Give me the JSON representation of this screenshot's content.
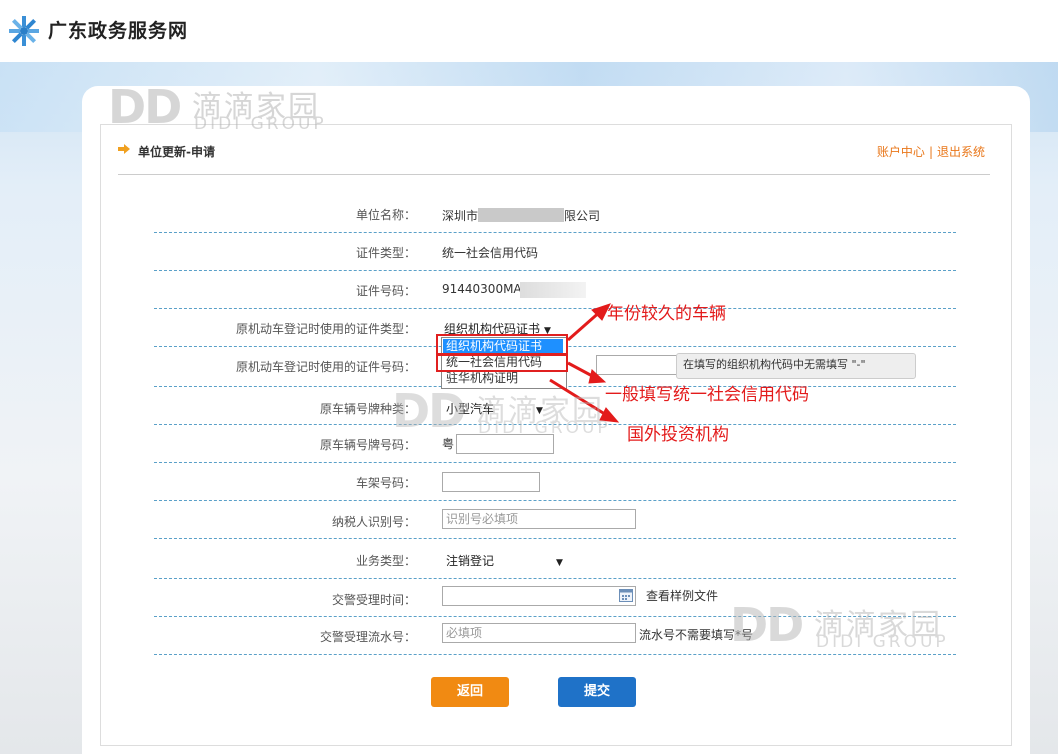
{
  "site": {
    "title": "广东政务服务网"
  },
  "watermark": {
    "mark": "DD",
    "cn": "滴滴家园",
    "en": "DIDI GROUP"
  },
  "panel": {
    "title": "单位更新-申请",
    "links": {
      "account": "账户中心",
      "sep": "|",
      "logout": "退出系统"
    }
  },
  "form": {
    "company_name": {
      "label": "单位名称：",
      "value_prefix": "深圳市",
      "value_suffix": "限公司"
    },
    "cert_type": {
      "label": "证件类型：",
      "value": "统一社会信用代码"
    },
    "cert_no": {
      "label": "证件号码：",
      "value": "91440300MA"
    },
    "orig_cert_type": {
      "label": "原机动车登记时使用的证件类型：",
      "selected": "组织机构代码证书"
    },
    "orig_cert_no": {
      "label": "原机动车登记时使用的证件号码：",
      "hint": "在填写的组织机构代码中无需填写 \"-\""
    },
    "plate_type": {
      "label": "原车辆号牌种类：",
      "selected": "小型汽车"
    },
    "plate_no": {
      "label": "原车辆号牌号码：",
      "prefix": "粤"
    },
    "vin": {
      "label": "车架号码："
    },
    "taxpayer_id": {
      "label": "纳税人识别号：",
      "placeholder": "识别号必填项"
    },
    "biz_type": {
      "label": "业务类型：",
      "selected": "注销登记"
    },
    "accept_time": {
      "label": "交警受理时间：",
      "example_link": "查看样例文件"
    },
    "serial_no": {
      "label": "交警受理流水号：",
      "placeholder": "必填项",
      "note": "流水号不需要填写*号"
    }
  },
  "dropdown": {
    "options": [
      "组织机构代码证书",
      "统一社会信用代码",
      "驻华机构证明"
    ]
  },
  "annotations": {
    "old_vehicle": "年份较久的车辆",
    "general": "一般填写统一社会信用代码",
    "foreign": "国外投资机构"
  },
  "buttons": {
    "back": "返回",
    "submit": "提交"
  },
  "colors": {
    "accent": "#e9771a",
    "primary": "#1f72c8",
    "back": "#f18a12",
    "anno": "#e31b1b"
  }
}
